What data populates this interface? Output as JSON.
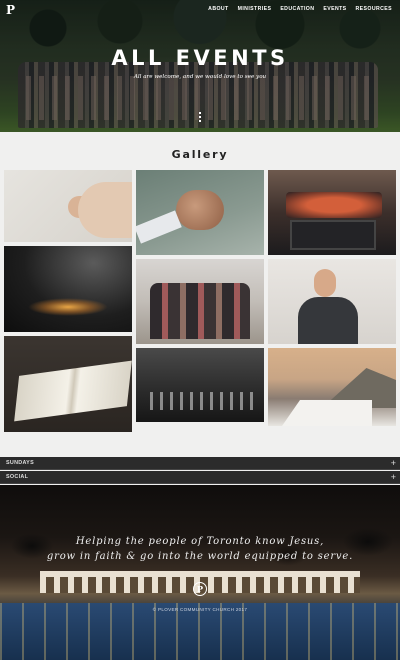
{
  "header": {
    "logo": "P",
    "nav": [
      "ABOUT",
      "MINISTRIES",
      "EDUCATION",
      "EVENTS",
      "RESOURCES"
    ]
  },
  "hero": {
    "title": "ALL EVENTS",
    "subtitle": "All are welcome, and we would love to see you"
  },
  "gallery": {
    "title": "Gallery",
    "images": [
      "hands-prayer",
      "team-fist-bump",
      "bbq-grill",
      "candles-dark",
      "group-photo",
      "smiling-man",
      "open-bible",
      "worship-stage",
      "coastal-cliff"
    ]
  },
  "sections": [
    {
      "label": "SUNDAYS"
    },
    {
      "label": "SOCIAL"
    }
  ],
  "footer": {
    "line1": "Helping the people of Toronto know Jesus,",
    "line2": "grow in faith & go into the world equipped to serve.",
    "logo": "P",
    "copyright": "© PLOVER COMMUNITY CHURCH 2017"
  }
}
